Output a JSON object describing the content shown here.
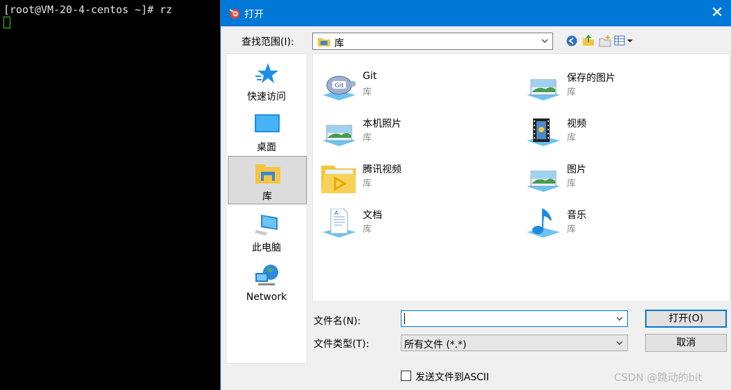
{
  "terminal": {
    "prompt_line": "[root@VM-20-4-centos ~]# rz"
  },
  "dialog": {
    "title": "打开",
    "close_glyph": "✕",
    "look_in_label": "查找范围(I):",
    "look_in_value": "库",
    "places": [
      {
        "label": "快速访问",
        "icon": "star-icon"
      },
      {
        "label": "桌面",
        "icon": "desktop-icon"
      },
      {
        "label": "库",
        "icon": "library-icon",
        "selected": true
      },
      {
        "label": "此电脑",
        "icon": "computer-icon"
      },
      {
        "label": "Network",
        "icon": "network-icon"
      }
    ],
    "files": [
      {
        "name": "Git",
        "type": "库",
        "icon": "git-library-icon"
      },
      {
        "name": "保存的图片",
        "type": "库",
        "icon": "pictures-library-icon"
      },
      {
        "name": "本机照片",
        "type": "库",
        "icon": "pictures-library-icon"
      },
      {
        "name": "视频",
        "type": "库",
        "icon": "videos-library-icon"
      },
      {
        "name": "腾讯视频",
        "type": "库",
        "icon": "tencent-video-folder-icon"
      },
      {
        "name": "图片",
        "type": "库",
        "icon": "pictures-library-icon"
      },
      {
        "name": "文档",
        "type": "库",
        "icon": "documents-library-icon"
      },
      {
        "name": "音乐",
        "type": "库",
        "icon": "music-library-icon"
      }
    ],
    "filename_label": "文件名(N):",
    "filename_value": "",
    "filetype_label": "文件类型(T):",
    "filetype_value": "所有文件 (*.*)",
    "open_button": "打开(O)",
    "cancel_button": "取消",
    "ascii_checkbox_label": "发送文件到ASCII",
    "ascii_checked": false
  },
  "watermark": "CSDN @跳动的bit",
  "colors": {
    "titlebar": "#0078d7",
    "terminal_bg": "#000000",
    "cursor": "#3bd13b"
  }
}
